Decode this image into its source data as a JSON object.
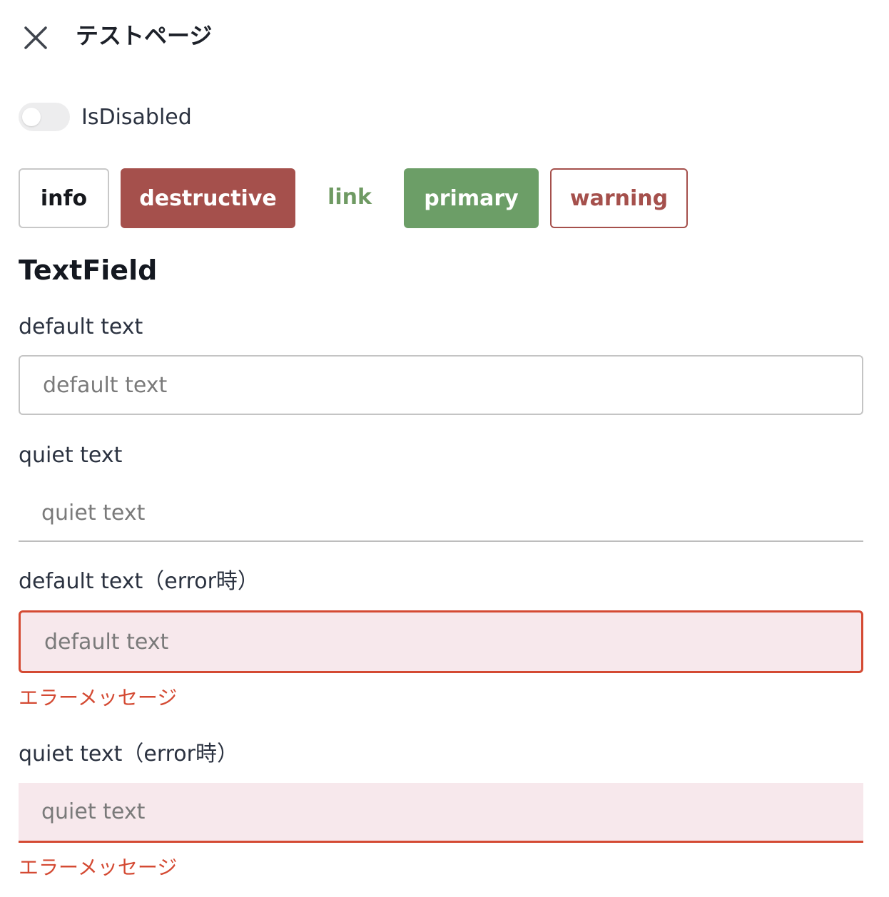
{
  "header": {
    "title": "テストページ",
    "close_icon": "close-icon"
  },
  "toggle": {
    "label": "IsDisabled",
    "checked": false
  },
  "buttons": {
    "info": "info",
    "destructive": "destructive",
    "link": "link",
    "primary": "primary",
    "warning": "warning"
  },
  "section": {
    "title": "TextField"
  },
  "fields": {
    "default": {
      "label": "default text",
      "placeholder": "default text"
    },
    "quiet": {
      "label": "quiet text",
      "placeholder": "quiet text"
    },
    "default_error": {
      "label": "default text（error時）",
      "placeholder": "default text",
      "error": "エラーメッセージ"
    },
    "quiet_error": {
      "label": "quiet text（error時）",
      "placeholder": "quiet text",
      "error": "エラーメッセージ"
    }
  },
  "colors": {
    "destructive": "#a5504c",
    "primary": "#6c9e67",
    "link": "#6f9a63",
    "error": "#d44a33",
    "error_bg": "#f7e8ec"
  }
}
